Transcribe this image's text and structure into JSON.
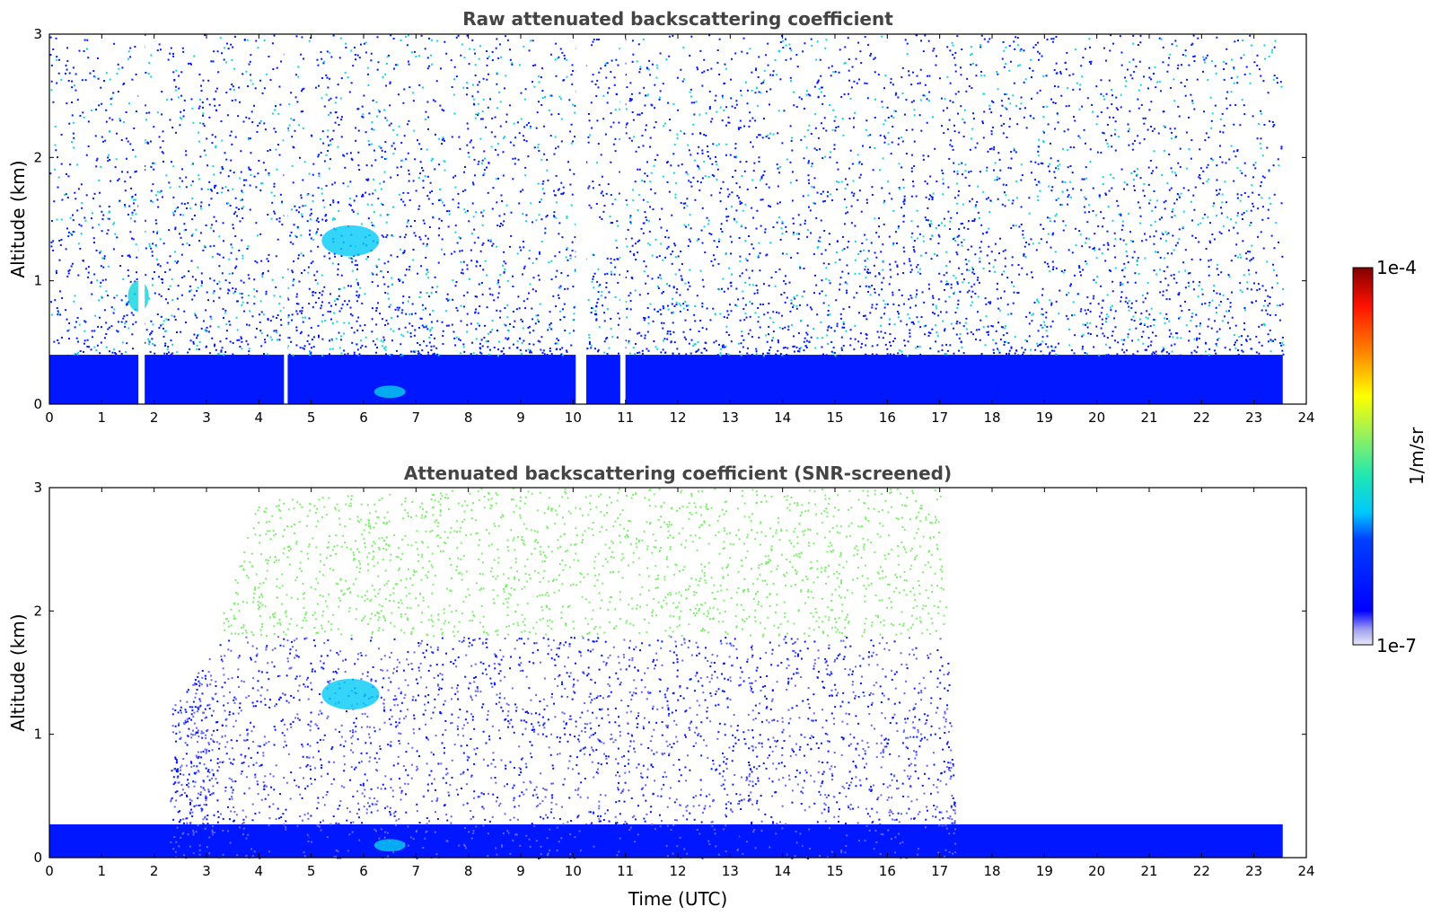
{
  "chart_data": [
    {
      "type": "heatmap",
      "title": "Raw attenuated backscattering coefficient",
      "xlabel": "",
      "ylabel": "Altitude (km)",
      "xlim": [
        0,
        24
      ],
      "ylim": [
        0,
        3
      ],
      "x_ticks": [
        "0",
        "1",
        "2",
        "3",
        "4",
        "5",
        "6",
        "7",
        "8",
        "9",
        "10",
        "11",
        "12",
        "13",
        "14",
        "15",
        "16",
        "17",
        "18",
        "19",
        "20",
        "21",
        "22",
        "23",
        "24"
      ],
      "y_ticks": [
        "0",
        "1",
        "2",
        "3"
      ],
      "data_end_time": 23.55,
      "ground_layer_top_km": 0.4,
      "ground_layer_value": 3e-07,
      "upper_noise_value": 8e-07,
      "features": [
        {
          "type": "cloud",
          "time": [
            1.5,
            1.9
          ],
          "altitude": [
            0.75,
            1.0
          ],
          "value": 1.5e-06
        },
        {
          "type": "aerosol",
          "time": [
            5.2,
            6.3
          ],
          "altitude": [
            1.2,
            1.45
          ],
          "value": 1.2e-06
        },
        {
          "type": "aerosol",
          "time": [
            6.2,
            6.8
          ],
          "altitude": [
            0.05,
            0.15
          ],
          "value": 1.3e-06
        }
      ],
      "no_data_time_intervals": [
        [
          1.7,
          1.82
        ],
        [
          4.48,
          4.55
        ],
        [
          10.05,
          10.25
        ],
        [
          10.9,
          11.0
        ]
      ]
    },
    {
      "type": "heatmap",
      "title": "Attenuated backscattering coefficient (SNR-screened)",
      "xlabel": "Time (UTC)",
      "ylabel": "Altitude (km)",
      "xlim": [
        0,
        24
      ],
      "ylim": [
        0,
        3
      ],
      "x_ticks": [
        "0",
        "1",
        "2",
        "3",
        "4",
        "5",
        "6",
        "7",
        "8",
        "9",
        "10",
        "11",
        "12",
        "13",
        "14",
        "15",
        "16",
        "17",
        "18",
        "19",
        "20",
        "21",
        "22",
        "23",
        "24"
      ],
      "y_ticks": [
        "0",
        "1",
        "2",
        "3"
      ],
      "data_end_time": 23.55,
      "screened_top_km": [
        [
          0,
          0.28
        ],
        [
          2.3,
          1.2
        ],
        [
          3.0,
          1.6
        ],
        [
          4.0,
          2.9
        ],
        [
          8.0,
          3.0
        ],
        [
          14.0,
          3.0
        ],
        [
          17.0,
          3.0
        ],
        [
          17.3,
          0.27
        ],
        [
          23.55,
          0.27
        ]
      ],
      "features": [
        {
          "type": "aerosol",
          "time": [
            5.2,
            6.3
          ],
          "altitude": [
            1.2,
            1.45
          ],
          "value": 1.2e-06
        },
        {
          "type": "aerosol",
          "time": [
            6.2,
            6.8
          ],
          "altitude": [
            0.05,
            0.15
          ],
          "value": 1.3e-06
        }
      ]
    }
  ],
  "colorbar": {
    "label": "1/m/sr",
    "min_label": "1e-7",
    "max_label": "1e-4",
    "min": 1e-07,
    "max": 0.0001,
    "scale": "log",
    "colormap": "jet"
  }
}
